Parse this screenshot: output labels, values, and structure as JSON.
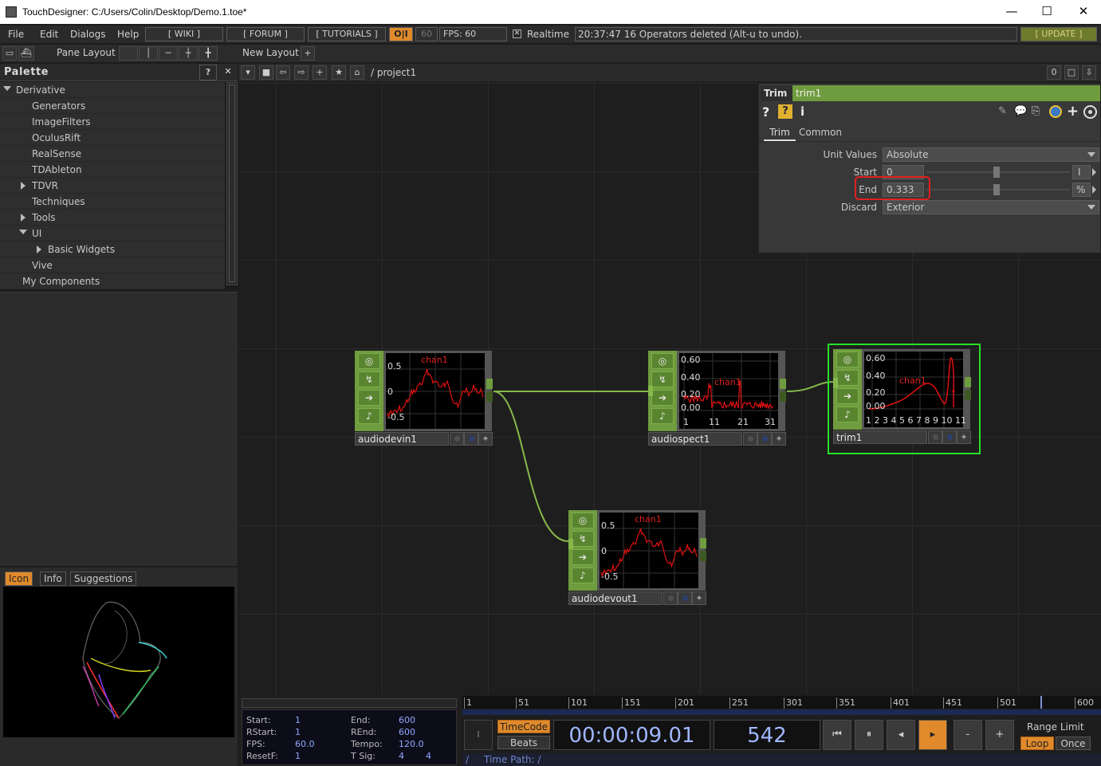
{
  "window": {
    "title": "TouchDesigner: C:/Users/Colin/Desktop/Demo.1.toe*",
    "minimize": "—",
    "maximize": "☐",
    "close": "✕"
  },
  "menu": {
    "items": [
      "File",
      "Edit",
      "Dialogs",
      "Help"
    ],
    "wiki": "[ WIKI ]",
    "forum": "[ FORUM ]",
    "tutorials": "[ TUTORIALS ]",
    "oi": "O|I",
    "fps_box": "60",
    "fps_label": "FPS:  60",
    "realtime": "Realtime",
    "status": "20:37:47 16 Operators deleted (Alt-u to undo).",
    "update": "[ UPDATE ]"
  },
  "layoutbar": {
    "pane_layout": "Pane Layout",
    "new_layout": "New Layout",
    "plus": "+"
  },
  "palette": {
    "title": "Palette",
    "help": "?",
    "close": "✕",
    "items": [
      {
        "label": "Derivative",
        "indent": 0,
        "arrow": "down"
      },
      {
        "label": "Generators",
        "indent": 2,
        "arrow": "none"
      },
      {
        "label": "ImageFilters",
        "indent": 2,
        "arrow": "none"
      },
      {
        "label": "OculusRift",
        "indent": 2,
        "arrow": "none"
      },
      {
        "label": "RealSense",
        "indent": 2,
        "arrow": "none"
      },
      {
        "label": "TDAbleton",
        "indent": 2,
        "arrow": "none"
      },
      {
        "label": "TDVR",
        "indent": 1,
        "arrow": "right"
      },
      {
        "label": "Techniques",
        "indent": 2,
        "arrow": "none"
      },
      {
        "label": "Tools",
        "indent": 1,
        "arrow": "right"
      },
      {
        "label": "UI",
        "indent": 1,
        "arrow": "down"
      },
      {
        "label": "Basic Widgets",
        "indent": 3,
        "arrow": "right"
      },
      {
        "label": "Vive",
        "indent": 2,
        "arrow": "none"
      },
      {
        "label": "My Components",
        "indent": 1,
        "arrow": "none"
      }
    ]
  },
  "iconpanel": {
    "tabs": [
      "Icon",
      "Info",
      "Suggestions"
    ]
  },
  "network": {
    "path": "/ project1",
    "right_count": "0"
  },
  "operators": {
    "audiodevin1": {
      "name": "audiodevin1",
      "chan": "chan1",
      "y_labels": [
        "0.5",
        "0",
        "-0.5"
      ]
    },
    "audiospect1": {
      "name": "audiospect1",
      "chan": "chan1",
      "y_labels": [
        "0.60",
        "0.40",
        "0.20",
        "0.00"
      ],
      "x_labels": [
        "1",
        "11",
        "21",
        "31"
      ]
    },
    "trim1": {
      "name": "trim1",
      "chan": "chan1",
      "y_labels": [
        "0.60",
        "0.40",
        "0.20",
        "0.00"
      ],
      "x_labels": "1 2 3 4 5 6 7 8 9 10 11"
    },
    "audiodevout1": {
      "name": "audiodevout1",
      "chan": "chan1",
      "y_labels": [
        "0.5",
        "0",
        "-0.5"
      ]
    }
  },
  "params": {
    "type": "Trim",
    "name": "trim1",
    "tabs": [
      "Trim",
      "Common"
    ],
    "unit_values_label": "Unit Values",
    "unit_values": "Absolute",
    "start_label": "Start",
    "start_value": "0",
    "start_unit": "I",
    "end_label": "End",
    "end_value": "0.333",
    "end_unit": "%",
    "discard_label": "Discard",
    "discard_value": "Exterior"
  },
  "timeinfo": {
    "start_label": "Start:",
    "start": "1",
    "end_label": "End:",
    "end": "600",
    "rstart_label": "RStart:",
    "rstart": "1",
    "rend_label": "REnd:",
    "rend": "600",
    "fps_label": "FPS:",
    "fps": "60.0",
    "tempo_label": "Tempo:",
    "tempo": "120.0",
    "resetf_label": "ResetF:",
    "resetf": "1",
    "tsig_label": "T Sig:",
    "tsig_a": "4",
    "tsig_b": "4"
  },
  "timeline": {
    "ticks": [
      "1",
      "51",
      "101",
      "151",
      "201",
      "251",
      "301",
      "351",
      "401",
      "451",
      "501",
      "600"
    ],
    "timecode_btn": "TimeCode",
    "beats_btn": "Beats",
    "timecode": "00:00:09.01",
    "frame": "542",
    "range_limit": "Range Limit",
    "loop": "Loop",
    "once": "Once",
    "time_path": "Time Path: /",
    "slash": "/",
    "minus": "-",
    "plus": "+"
  },
  "colors": {
    "chop_green": "#6f9c3e",
    "selected_border": "#26e026",
    "accent_orange": "#e08a2c",
    "wire_green": "#86b84a",
    "signal_red": "#e01010",
    "highlight_red": "#e02020"
  }
}
